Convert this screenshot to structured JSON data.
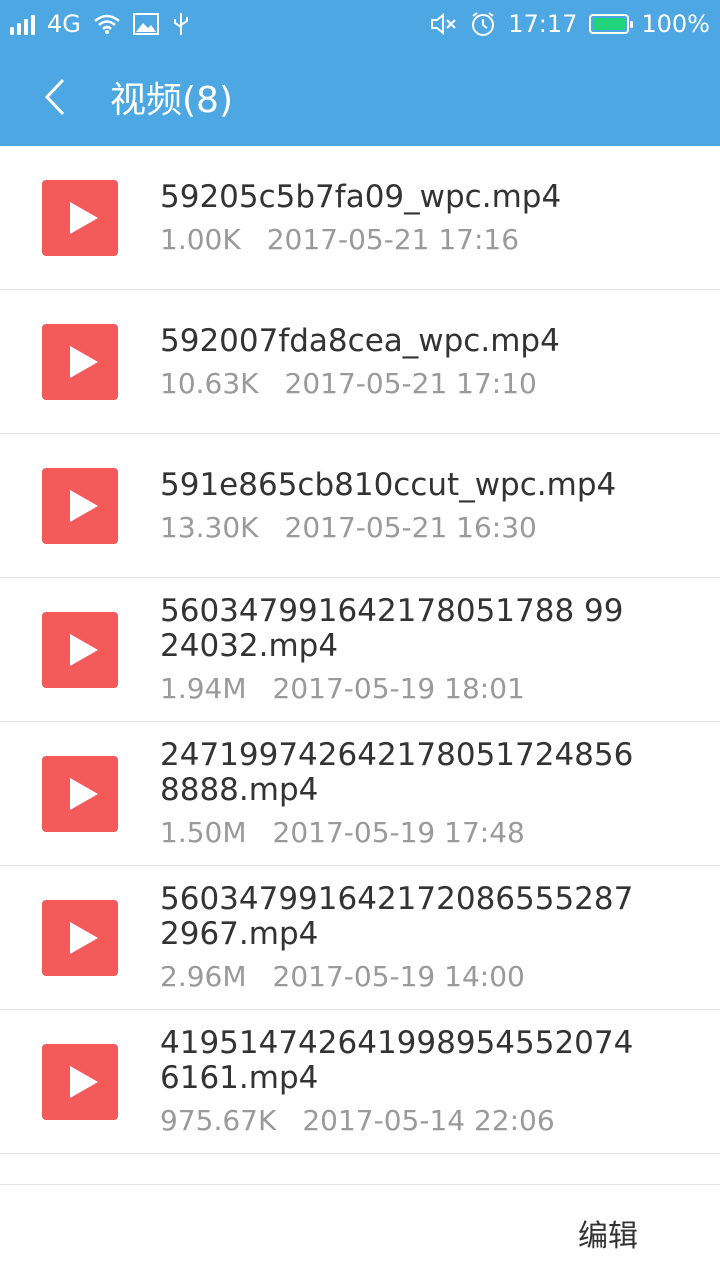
{
  "status": {
    "network": "4G",
    "time": "17:17",
    "battery": "100%",
    "icons": [
      "signal-icon",
      "wifi-icon",
      "image-icon",
      "usb-icon",
      "mute-icon",
      "alarm-icon",
      "battery-icon"
    ]
  },
  "header": {
    "title": "视频(8)",
    "back_icon": "chevron-left-icon"
  },
  "videos": [
    {
      "name": "59205c5b7fa09_wpc.mp4",
      "size": "1.00K",
      "date": "2017-05-21 17:16"
    },
    {
      "name": "592007fda8cea_wpc.mp4",
      "size": "10.63K",
      "date": "2017-05-21 17:10"
    },
    {
      "name": "591e865cb810ccut_wpc.mp4",
      "size": "13.30K",
      "date": "2017-05-21 16:30"
    },
    {
      "name": "560347991642178051788 9924032.mp4",
      "size": "1.94M",
      "date": "2017-05-19 18:01"
    },
    {
      "name": "2471997426421780517248568888.mp4",
      "size": "1.50M",
      "date": "2017-05-19 17:48"
    },
    {
      "name": "5603479916421720865552872967.mp4",
      "size": "2.96M",
      "date": "2017-05-19 14:00"
    },
    {
      "name": "4195147426419989545520746161.mp4",
      "size": "975.67K",
      "date": "2017-05-14 22:06"
    }
  ],
  "bottom": {
    "edit_label": "编辑"
  },
  "colors": {
    "appbar": "#4DA7E2",
    "play_icon_bg": "#F45A5A",
    "battery_fill": "#1FD47A"
  }
}
